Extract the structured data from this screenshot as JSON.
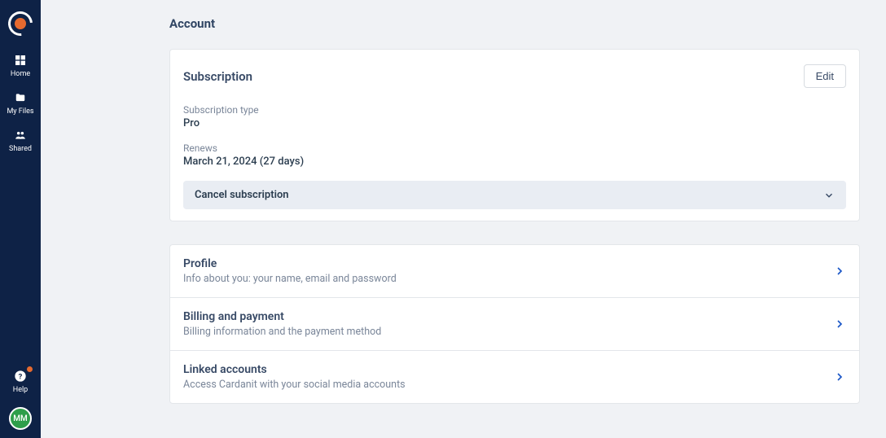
{
  "nav": {
    "home": "Home",
    "myfiles": "My Files",
    "shared": "Shared",
    "help": "Help"
  },
  "user": {
    "initials": "MM"
  },
  "page": {
    "title": "Account"
  },
  "subscription": {
    "heading": "Subscription",
    "edit_label": "Edit",
    "type_label": "Subscription type",
    "type_value": "Pro",
    "renews_label": "Renews",
    "renews_value": "March 21, 2024 (27 days)",
    "cancel_label": "Cancel subscription"
  },
  "sections": {
    "profile": {
      "title": "Profile",
      "desc": "Info about you: your name, email and password"
    },
    "billing": {
      "title": "Billing and payment",
      "desc": "Billing information and the payment method"
    },
    "linked": {
      "title": "Linked accounts",
      "desc": "Access Cardanit with your social media accounts"
    }
  }
}
